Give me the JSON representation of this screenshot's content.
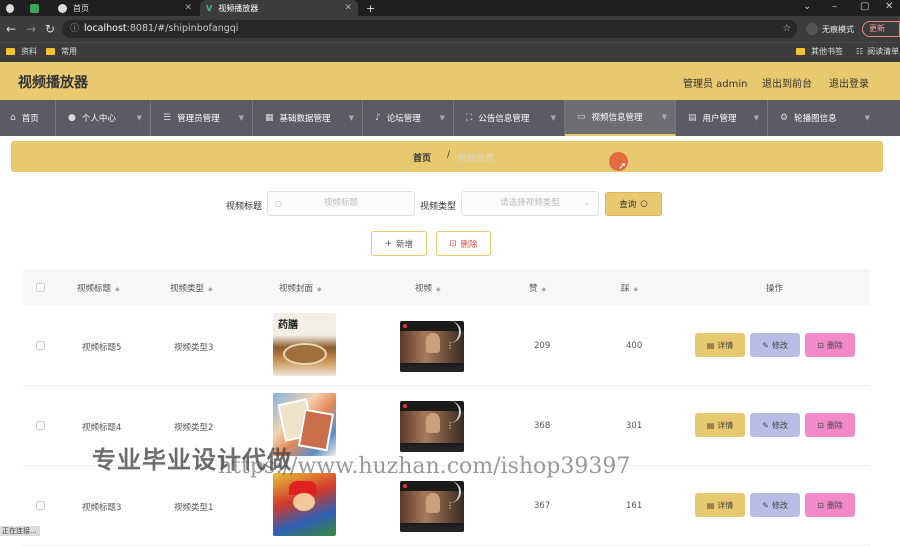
{
  "browser": {
    "tabs": [
      {
        "label": "首页"
      },
      {
        "label": "首页"
      },
      {
        "label": "视频播放器"
      }
    ],
    "url_host": "localhost",
    "url_path": ":8081/#/shipinbofangqi",
    "incognito_label": "无痕模式",
    "update_label": "更新",
    "bookmarks": [
      "资料",
      "常用"
    ],
    "bookmarks_right": [
      "其他书签",
      "阅读清单"
    ]
  },
  "header": {
    "title": "视频播放器",
    "admin_label": "管理员 admin",
    "back_label": "退出到前台",
    "logout_label": "退出登录"
  },
  "menu": [
    {
      "label": "首页",
      "icon": "home-icon"
    },
    {
      "label": "个人中心",
      "icon": "user-icon"
    },
    {
      "label": "管理员管理",
      "icon": "list-icon"
    },
    {
      "label": "基础数据管理",
      "icon": "grid-icon"
    },
    {
      "label": "论坛管理",
      "icon": "mic-icon"
    },
    {
      "label": "公告信息管理",
      "icon": "expand-icon"
    },
    {
      "label": "视频信息管理",
      "icon": "video-icon"
    },
    {
      "label": "用户管理",
      "icon": "users-icon"
    },
    {
      "label": "轮播图信息",
      "icon": "gear-icon"
    }
  ],
  "breadcrumb": {
    "home": "首页",
    "separator": "/",
    "current": "视频信息"
  },
  "search": {
    "title_label": "视频标题",
    "title_placeholder": "视频标题",
    "type_label": "视频类型",
    "type_placeholder": "请选择视频类型",
    "query_label": "查询"
  },
  "actions": {
    "add_label": "新增",
    "delete_label": "删除"
  },
  "table": {
    "headers": [
      "视频标题",
      "视频类型",
      "视频封面",
      "视频",
      "赞",
      "踩",
      "操作"
    ],
    "rows": [
      {
        "title": "视频标题5",
        "type": "视频类型3",
        "likes": "209",
        "dislikes": "400"
      },
      {
        "title": "视频标题4",
        "type": "视频类型2",
        "likes": "368",
        "dislikes": "301"
      },
      {
        "title": "视频标题3",
        "type": "视频类型1",
        "likes": "367",
        "dislikes": "161"
      }
    ],
    "detail_label": "详情",
    "edit_label": "修改",
    "delete_label": "删除"
  },
  "cover_texts": [
    "药膳"
  ],
  "watermark": {
    "line1": "专业毕业设计代做",
    "line2": "https://www.huzhan.com/ishop39397"
  },
  "status_text": "正在连接...",
  "colors": {
    "accent": "#e8c96f",
    "menubar": "#5b5b63",
    "edit": "#b9bde6",
    "delete": "#f28ac9"
  }
}
